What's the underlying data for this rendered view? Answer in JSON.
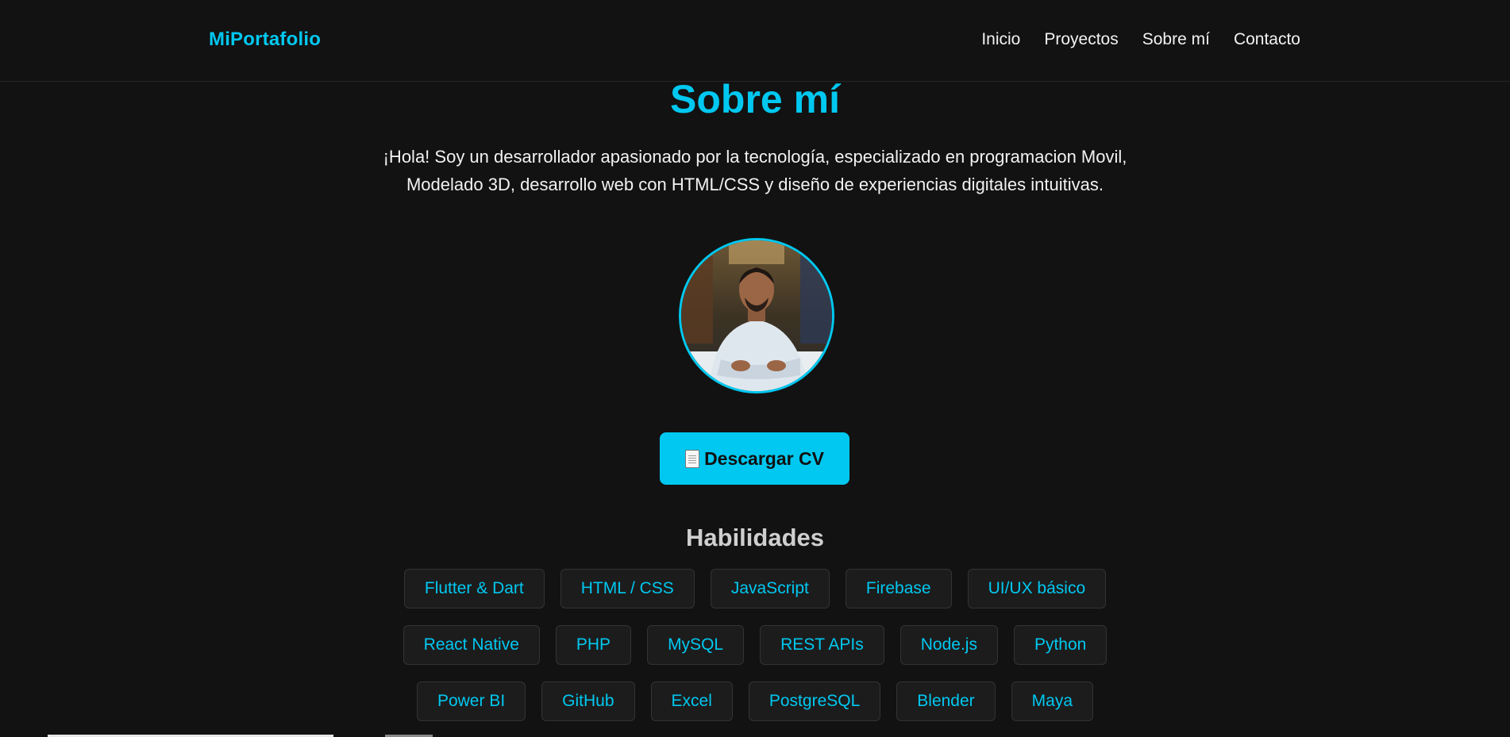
{
  "navbar": {
    "brand": "MiPortafolio",
    "links": [
      "Inicio",
      "Proyectos",
      "Sobre mí",
      "Contacto"
    ]
  },
  "about": {
    "title": "Sobre mí",
    "intro_line1": "¡Hola! Soy un desarrollador apasionado por la tecnología, especializado en programacion Movil,",
    "intro_line2": "Modelado 3D, desarrollo web con HTML/CSS y diseño de experiencias digitales intuitivas.",
    "cv_button_label": "Descargar CV",
    "cv_button_icon": "document-icon"
  },
  "skills": {
    "title": "Habilidades",
    "rows": [
      [
        "Flutter & Dart",
        "HTML / CSS",
        "JavaScript",
        "Firebase",
        "UI/UX básico"
      ],
      [
        "React Native",
        "PHP",
        "MySQL",
        "REST APIs",
        "Node.js",
        "Python"
      ],
      [
        "Power BI",
        "GitHub",
        "Excel",
        "PostgreSQL",
        "Blender",
        "Maya"
      ]
    ]
  },
  "colors": {
    "accent": "#00c8f0",
    "background": "#121212",
    "tag_background": "#1c1c1c"
  }
}
